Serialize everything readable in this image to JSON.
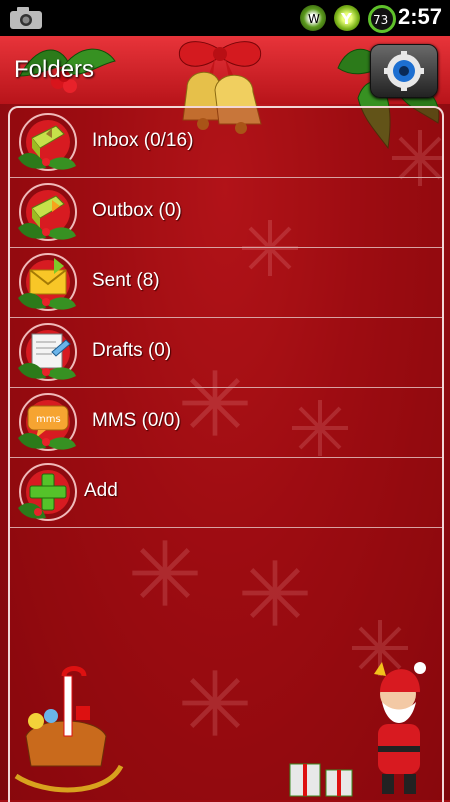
{
  "status_bar": {
    "time": "2:57",
    "battery_level": "73",
    "icons": [
      "camera-icon",
      "wifi-w-icon",
      "signal-y-icon",
      "battery-icon"
    ]
  },
  "header": {
    "title": "Folders",
    "settings_icon": "gear-icon"
  },
  "folders": [
    {
      "label": "Inbox (0/16)",
      "icon": "inbox-icon"
    },
    {
      "label": "Outbox (0)",
      "icon": "outbox-icon"
    },
    {
      "label": "Sent (8)",
      "icon": "sent-icon"
    },
    {
      "label": "Drafts (0)",
      "icon": "drafts-icon"
    },
    {
      "label": "MMS (0/0)",
      "icon": "mms-icon"
    },
    {
      "label": "Add",
      "icon": "add-icon"
    }
  ],
  "mms_badge_text": "mms",
  "colors": {
    "background": "#a30d14",
    "header": "#d0242a",
    "divider": "#d7a2a2",
    "text": "#ffffff"
  }
}
